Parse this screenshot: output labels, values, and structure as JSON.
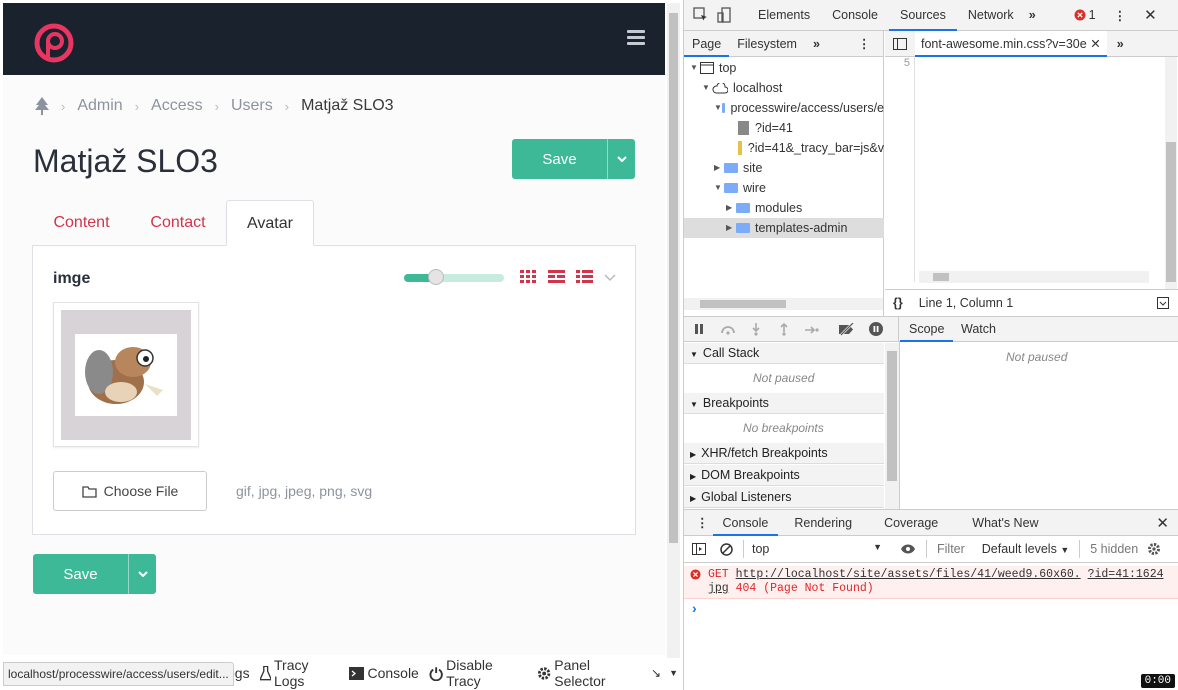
{
  "admin": {
    "breadcrumbs": [
      "Admin",
      "Access",
      "Users",
      "Matjaž SLO3"
    ],
    "page_title": "Matjaž SLO3",
    "save_label": "Save",
    "tabs": [
      "Content",
      "Contact",
      "Avatar"
    ],
    "field_label": "imge",
    "choose_file_label": "Choose File",
    "extensions": "gif, jpg, jpeg, png, svg",
    "image_size_fraction": 0.32
  },
  "status_url": "localhost/processwire/access/users/edit...",
  "tracy": {
    "logs": "ogs",
    "tracy_logs": "Tracy Logs",
    "console": "Console",
    "disable": "Disable Tracy",
    "panel_selector": "Panel Selector"
  },
  "devtools": {
    "top_tabs": [
      "Elements",
      "Console",
      "Sources",
      "Network"
    ],
    "error_count": "1",
    "nav_tabs": [
      "Page",
      "Filesystem"
    ],
    "tree": [
      "top",
      "localhost",
      "processwire/access/users/e",
      "?id=41",
      "?id=41&_tracy_bar=js&v",
      "site",
      "wire",
      "modules",
      "templates-admin"
    ],
    "editor_tab": "font-awesome.min.css?v=30e",
    "line_number": "5",
    "cursor_position": "Line 1, Column 1",
    "debug_tabs": [
      "Scope",
      "Watch"
    ],
    "sections": [
      "Call Stack",
      "Breakpoints",
      "XHR/fetch Breakpoints",
      "DOM Breakpoints",
      "Global Listeners"
    ],
    "not_paused": "Not paused",
    "no_breakpoints": "No breakpoints",
    "drawer_tabs": [
      "Console",
      "Rendering",
      "Coverage",
      "What's New"
    ],
    "context": "top",
    "filter_placeholder": "Filter",
    "levels": "Default levels",
    "hidden": "5 hidden",
    "error_method": "GET",
    "error_url": "http://localhost/site/assets/files/41/weed9.60x60.",
    "error_link": "?id=41:1624",
    "error_ext": "jpg",
    "error_status": "404 (Page Not Found)",
    "prompt": "›"
  },
  "colors": {
    "accent": "#3eb998",
    "brand": "#e83561",
    "link": "#d4334c",
    "header": "#1a222e"
  },
  "timecode": "0:00"
}
